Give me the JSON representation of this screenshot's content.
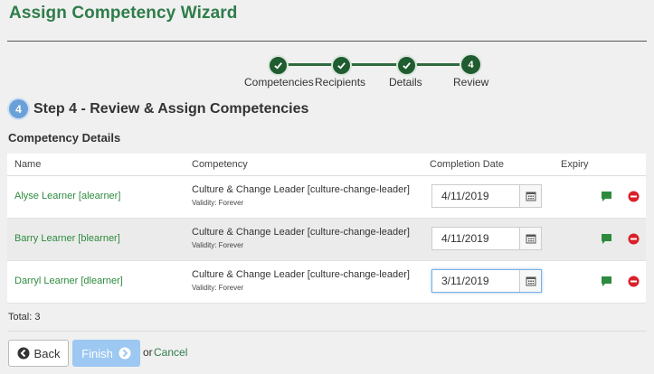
{
  "wizard": {
    "title": "Assign Competency Wizard"
  },
  "steps": [
    {
      "label": "Competencies",
      "status": "complete"
    },
    {
      "label": "Recipients",
      "status": "complete"
    },
    {
      "label": "Details",
      "status": "complete"
    },
    {
      "label": "Review",
      "status": "active",
      "number": "4"
    }
  ],
  "step_heading": {
    "number": "4",
    "text": "Step 4 - Review & Assign Competencies"
  },
  "section_title": "Competency Details",
  "table": {
    "columns": [
      "Name",
      "Competency",
      "Completion Date",
      "Expiry"
    ],
    "rows": [
      {
        "name": "Alyse Learner [alearner]",
        "competency": "Culture & Change Leader [culture-change-leader]",
        "validity": "Validity: Forever",
        "date": "4/11/2019"
      },
      {
        "name": "Barry Learner [blearner]",
        "competency": "Culture & Change Leader [culture-change-leader]",
        "validity": "Validity: Forever",
        "date": "4/11/2019"
      },
      {
        "name": "Darryl Learner [dlearner]",
        "competency": "Culture & Change Leader [culture-change-leader]",
        "validity": "Validity: Forever",
        "date": "3/11/2019"
      }
    ]
  },
  "total": "Total: 3",
  "footer": {
    "back": "Back",
    "finish": "Finish",
    "or": "or",
    "cancel": "Cancel"
  },
  "colors": {
    "brand_green": "#2e7d4a",
    "step_dark": "#1f5c2f",
    "badge_blue": "#6aa0d8",
    "finish_blue": "#9cc8f2",
    "remove_red": "#d9202a",
    "comment_green": "#2e8b3e"
  },
  "icons": {
    "complete_step": "check-icon",
    "date": "calendar-icon",
    "row_comment": "comment-icon",
    "row_remove": "minus-circle-icon",
    "back": "arrow-left-circle-icon",
    "finish": "arrow-right-circle-icon"
  }
}
